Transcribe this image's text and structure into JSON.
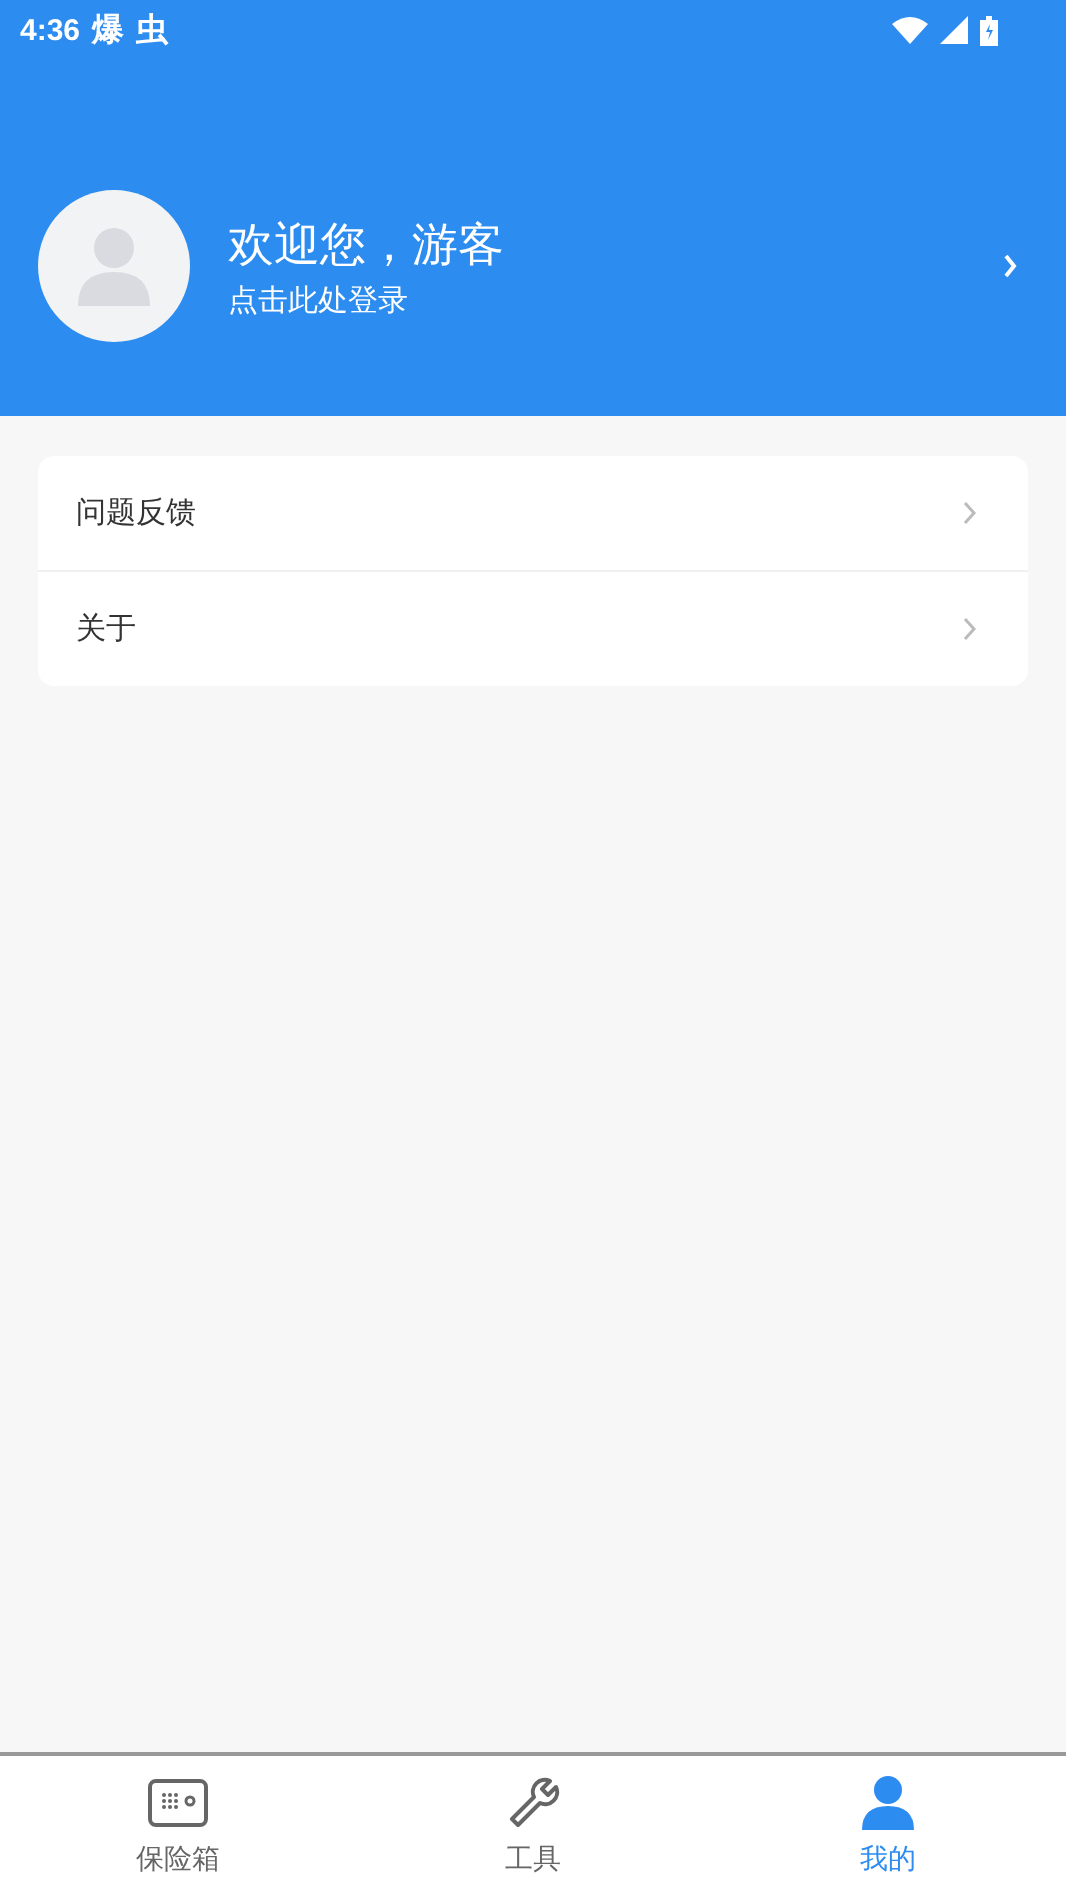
{
  "status_bar": {
    "time": "4:36",
    "notifications": [
      "爆",
      "虫"
    ]
  },
  "profile": {
    "greeting": "欢迎您，游客",
    "subtitle": "点击此处登录"
  },
  "menu": [
    {
      "label": "问题反馈"
    },
    {
      "label": "关于"
    }
  ],
  "bottom_nav": [
    {
      "label": "保险箱",
      "kind": "safe",
      "selected": false
    },
    {
      "label": "工具",
      "kind": "wrench",
      "selected": false
    },
    {
      "label": "我的",
      "kind": "person",
      "selected": true
    }
  ]
}
